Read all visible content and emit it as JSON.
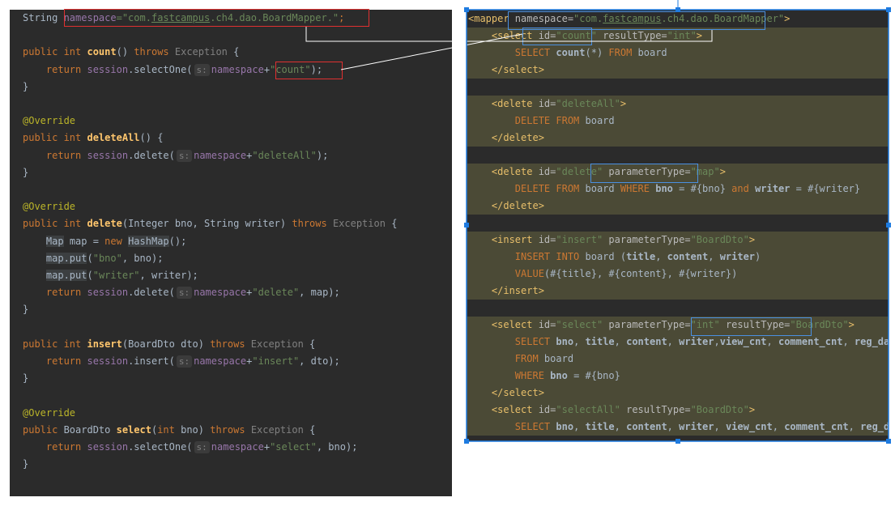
{
  "java": {
    "lines": [
      [
        {
          "t": "String ",
          "c": "mtd"
        },
        {
          "t": "namespace",
          "c": "fld"
        },
        {
          "t": "=\"com.",
          "c": "str"
        },
        {
          "t": "fastcampus",
          "c": "str ul"
        },
        {
          "t": ".ch4.dao.BoardMapper.\"",
          "c": "str"
        },
        {
          "t": ";",
          "c": "kw"
        }
      ],
      [],
      [
        {
          "t": "public int ",
          "c": "kw"
        },
        {
          "t": "count",
          "c": "fn"
        },
        {
          "t": "() ",
          "c": "mtd"
        },
        {
          "t": "throws ",
          "c": "kw"
        },
        {
          "t": "Exception",
          "c": "cls"
        },
        {
          "t": " {",
          "c": "mtd"
        }
      ],
      [
        {
          "t": "    return ",
          "c": "kw"
        },
        {
          "t": "session",
          "c": "fld"
        },
        {
          "t": ".selectOne(",
          "c": "mtd"
        },
        {
          "t": "s:",
          "c": "hint"
        },
        {
          "t": "namespace",
          "c": "fld"
        },
        {
          "t": "+",
          "c": "mtd"
        },
        {
          "t": "\"count\"",
          "c": "str"
        },
        {
          "t": ");",
          "c": "mtd"
        }
      ],
      [
        {
          "t": "}",
          "c": "mtd"
        }
      ],
      [],
      [
        {
          "t": "@Override",
          "c": "ann"
        }
      ],
      [
        {
          "t": "public int ",
          "c": "kw"
        },
        {
          "t": "deleteAll",
          "c": "fn"
        },
        {
          "t": "() {",
          "c": "mtd"
        }
      ],
      [
        {
          "t": "    return ",
          "c": "kw"
        },
        {
          "t": "session",
          "c": "fld"
        },
        {
          "t": ".delete(",
          "c": "mtd"
        },
        {
          "t": "s:",
          "c": "hint"
        },
        {
          "t": "namespace",
          "c": "fld"
        },
        {
          "t": "+",
          "c": "mtd"
        },
        {
          "t": "\"deleteAll\"",
          "c": "str"
        },
        {
          "t": ");",
          "c": "mtd"
        }
      ],
      [
        {
          "t": "}",
          "c": "mtd"
        }
      ],
      [],
      [
        {
          "t": "@Override",
          "c": "ann"
        }
      ],
      [
        {
          "t": "public int ",
          "c": "kw"
        },
        {
          "t": "delete",
          "c": "fn"
        },
        {
          "t": "(Integer bno, String writer) ",
          "c": "mtd"
        },
        {
          "t": "throws ",
          "c": "kw"
        },
        {
          "t": "Exception",
          "c": "cls"
        },
        {
          "t": " {",
          "c": "mtd"
        }
      ],
      [
        {
          "t": "    ",
          "c": "mtd"
        },
        {
          "t": "Map",
          "c": "mtd var"
        },
        {
          "t": " map = ",
          "c": "mtd"
        },
        {
          "t": "new ",
          "c": "kw"
        },
        {
          "t": "HashMap",
          "c": "mtd var"
        },
        {
          "t": "();",
          "c": "mtd"
        }
      ],
      [
        {
          "t": "    ",
          "c": "mtd"
        },
        {
          "t": "map.put",
          "c": "mtd var"
        },
        {
          "t": "(",
          "c": "mtd"
        },
        {
          "t": "\"bno\"",
          "c": "str"
        },
        {
          "t": ", bno);",
          "c": "mtd"
        }
      ],
      [
        {
          "t": "    ",
          "c": "mtd"
        },
        {
          "t": "map.put",
          "c": "mtd var"
        },
        {
          "t": "(",
          "c": "mtd"
        },
        {
          "t": "\"writer\"",
          "c": "str"
        },
        {
          "t": ", writer);",
          "c": "mtd"
        }
      ],
      [
        {
          "t": "    return ",
          "c": "kw"
        },
        {
          "t": "session",
          "c": "fld"
        },
        {
          "t": ".delete(",
          "c": "mtd"
        },
        {
          "t": "s:",
          "c": "hint"
        },
        {
          "t": "namespace",
          "c": "fld"
        },
        {
          "t": "+",
          "c": "mtd"
        },
        {
          "t": "\"delete\"",
          "c": "str"
        },
        {
          "t": ", map);",
          "c": "mtd"
        }
      ],
      [
        {
          "t": "}",
          "c": "mtd"
        }
      ],
      [],
      [
        {
          "t": "public int ",
          "c": "kw"
        },
        {
          "t": "insert",
          "c": "fn"
        },
        {
          "t": "(BoardDto dto) ",
          "c": "mtd"
        },
        {
          "t": "throws ",
          "c": "kw"
        },
        {
          "t": "Exception",
          "c": "cls"
        },
        {
          "t": " {",
          "c": "mtd"
        }
      ],
      [
        {
          "t": "    return ",
          "c": "kw"
        },
        {
          "t": "session",
          "c": "fld"
        },
        {
          "t": ".insert(",
          "c": "mtd"
        },
        {
          "t": "s:",
          "c": "hint"
        },
        {
          "t": "namespace",
          "c": "fld"
        },
        {
          "t": "+",
          "c": "mtd"
        },
        {
          "t": "\"insert\"",
          "c": "str"
        },
        {
          "t": ", dto);",
          "c": "mtd"
        }
      ],
      [
        {
          "t": "}",
          "c": "mtd"
        }
      ],
      [],
      [
        {
          "t": "@Override",
          "c": "ann"
        }
      ],
      [
        {
          "t": "public ",
          "c": "kw"
        },
        {
          "t": "BoardDto ",
          "c": "mtd"
        },
        {
          "t": "select",
          "c": "fn"
        },
        {
          "t": "(",
          "c": "mtd"
        },
        {
          "t": "int ",
          "c": "kw"
        },
        {
          "t": "bno) ",
          "c": "mtd"
        },
        {
          "t": "throws ",
          "c": "kw"
        },
        {
          "t": "Exception",
          "c": "cls"
        },
        {
          "t": " {",
          "c": "mtd"
        }
      ],
      [
        {
          "t": "    return ",
          "c": "kw"
        },
        {
          "t": "session",
          "c": "fld"
        },
        {
          "t": ".selectOne(",
          "c": "mtd"
        },
        {
          "t": "s:",
          "c": "hint"
        },
        {
          "t": "namespace",
          "c": "fld"
        },
        {
          "t": "+",
          "c": "mtd"
        },
        {
          "t": "\"select\"",
          "c": "str"
        },
        {
          "t": ", bno);",
          "c": "mtd"
        }
      ],
      [
        {
          "t": "}",
          "c": "mtd"
        }
      ]
    ]
  },
  "xml": {
    "lines": [
      {
        "hl": false,
        "s": [
          {
            "t": "<mapper ",
            "c": "tag"
          },
          {
            "t": "namespace=",
            "c": "attr"
          },
          {
            "t": "\"com.",
            "c": "aval"
          },
          {
            "t": "fastcampus",
            "c": "aval ul"
          },
          {
            "t": ".ch4.dao.BoardMapper\"",
            "c": "aval"
          },
          {
            "t": ">",
            "c": "tag"
          }
        ]
      },
      {
        "hl": true,
        "s": [
          {
            "t": "    <select ",
            "c": "tag"
          },
          {
            "t": "id=",
            "c": "attr"
          },
          {
            "t": "\"count\" ",
            "c": "aval"
          },
          {
            "t": "resultType=",
            "c": "attr"
          },
          {
            "t": "\"int\"",
            "c": "aval"
          },
          {
            "t": ">",
            "c": "tag"
          }
        ]
      },
      {
        "hl": true,
        "s": [
          {
            "t": "        SELECT ",
            "c": "sqk"
          },
          {
            "t": "count",
            "c": "sqi"
          },
          {
            "t": "(*) ",
            "c": "mtd"
          },
          {
            "t": "FROM ",
            "c": "sqk"
          },
          {
            "t": "board",
            "c": "mtd"
          }
        ]
      },
      {
        "hl": true,
        "s": [
          {
            "t": "    </select>",
            "c": "tag"
          }
        ]
      },
      {
        "hl": false,
        "s": []
      },
      {
        "hl": true,
        "s": [
          {
            "t": "    <delete ",
            "c": "tag"
          },
          {
            "t": "id=",
            "c": "attr"
          },
          {
            "t": "\"deleteAll\"",
            "c": "aval"
          },
          {
            "t": ">",
            "c": "tag"
          }
        ]
      },
      {
        "hl": true,
        "s": [
          {
            "t": "        DELETE FROM ",
            "c": "sqk"
          },
          {
            "t": "board",
            "c": "mtd"
          }
        ]
      },
      {
        "hl": true,
        "s": [
          {
            "t": "    </delete>",
            "c": "tag"
          }
        ]
      },
      {
        "hl": false,
        "s": []
      },
      {
        "hl": true,
        "s": [
          {
            "t": "    <delete ",
            "c": "tag"
          },
          {
            "t": "id=",
            "c": "attr"
          },
          {
            "t": "\"delete\" ",
            "c": "aval"
          },
          {
            "t": "parameterType=",
            "c": "attr"
          },
          {
            "t": "\"map\"",
            "c": "aval"
          },
          {
            "t": ">",
            "c": "tag"
          }
        ]
      },
      {
        "hl": true,
        "s": [
          {
            "t": "        DELETE FROM ",
            "c": "sqk"
          },
          {
            "t": "board ",
            "c": "mtd"
          },
          {
            "t": "WHERE ",
            "c": "sqk"
          },
          {
            "t": "bno ",
            "c": "sqi"
          },
          {
            "t": "= #{bno} ",
            "c": "mtd"
          },
          {
            "t": "and ",
            "c": "sqk"
          },
          {
            "t": "writer ",
            "c": "sqi"
          },
          {
            "t": "= #{writer}",
            "c": "mtd"
          }
        ]
      },
      {
        "hl": true,
        "s": [
          {
            "t": "    </delete>",
            "c": "tag"
          }
        ]
      },
      {
        "hl": false,
        "s": []
      },
      {
        "hl": true,
        "s": [
          {
            "t": "    <insert ",
            "c": "tag"
          },
          {
            "t": "id=",
            "c": "attr"
          },
          {
            "t": "\"insert\" ",
            "c": "aval"
          },
          {
            "t": "parameterType=",
            "c": "attr"
          },
          {
            "t": "\"BoardDto\"",
            "c": "aval"
          },
          {
            "t": ">",
            "c": "tag"
          }
        ]
      },
      {
        "hl": true,
        "s": [
          {
            "t": "        INSERT INTO ",
            "c": "sqk"
          },
          {
            "t": "board (",
            "c": "mtd"
          },
          {
            "t": "title",
            "c": "sqi"
          },
          {
            "t": ", ",
            "c": "mtd"
          },
          {
            "t": "content",
            "c": "sqi"
          },
          {
            "t": ", ",
            "c": "mtd"
          },
          {
            "t": "writer",
            "c": "sqi"
          },
          {
            "t": ")",
            "c": "mtd"
          }
        ]
      },
      {
        "hl": true,
        "s": [
          {
            "t": "        VALUE",
            "c": "sqk"
          },
          {
            "t": "(#{title}, #{content}, #{writer})",
            "c": "mtd"
          }
        ]
      },
      {
        "hl": true,
        "s": [
          {
            "t": "    </insert>",
            "c": "tag"
          }
        ]
      },
      {
        "hl": false,
        "s": []
      },
      {
        "hl": true,
        "s": [
          {
            "t": "    <select ",
            "c": "tag"
          },
          {
            "t": "id=",
            "c": "attr"
          },
          {
            "t": "\"select\" ",
            "c": "aval"
          },
          {
            "t": "parameterType=",
            "c": "attr"
          },
          {
            "t": "\"int\" ",
            "c": "aval"
          },
          {
            "t": "resultType=",
            "c": "attr"
          },
          {
            "t": "\"BoardDto\"",
            "c": "aval"
          },
          {
            "t": ">",
            "c": "tag"
          }
        ]
      },
      {
        "hl": true,
        "s": [
          {
            "t": "        SELECT ",
            "c": "sqk"
          },
          {
            "t": "bno",
            "c": "sqi"
          },
          {
            "t": ", ",
            "c": "mtd"
          },
          {
            "t": "title",
            "c": "sqi"
          },
          {
            "t": ", ",
            "c": "mtd"
          },
          {
            "t": "content",
            "c": "sqi"
          },
          {
            "t": ", ",
            "c": "mtd"
          },
          {
            "t": "writer",
            "c": "sqi"
          },
          {
            "t": ",",
            "c": "mtd"
          },
          {
            "t": "view_cnt",
            "c": "sqi"
          },
          {
            "t": ", ",
            "c": "mtd"
          },
          {
            "t": "comment_cnt",
            "c": "sqi"
          },
          {
            "t": ", ",
            "c": "mtd"
          },
          {
            "t": "reg_date",
            "c": "sqi"
          }
        ]
      },
      {
        "hl": true,
        "s": [
          {
            "t": "        FROM ",
            "c": "sqk"
          },
          {
            "t": "board",
            "c": "mtd"
          }
        ]
      },
      {
        "hl": true,
        "s": [
          {
            "t": "        WHERE ",
            "c": "sqk"
          },
          {
            "t": "bno ",
            "c": "sqi"
          },
          {
            "t": "= #{bno}",
            "c": "mtd"
          }
        ]
      },
      {
        "hl": true,
        "s": [
          {
            "t": "    </select>",
            "c": "tag"
          }
        ]
      },
      {
        "hl": true,
        "s": [
          {
            "t": "    <select ",
            "c": "tag"
          },
          {
            "t": "id=",
            "c": "attr"
          },
          {
            "t": "\"selectAll\" ",
            "c": "aval"
          },
          {
            "t": "resultType=",
            "c": "attr"
          },
          {
            "t": "\"BoardDto\"",
            "c": "aval"
          },
          {
            "t": ">",
            "c": "tag"
          }
        ]
      },
      {
        "hl": true,
        "s": [
          {
            "t": "        SELECT ",
            "c": "sqk"
          },
          {
            "t": "bno",
            "c": "sqi"
          },
          {
            "t": ", ",
            "c": "mtd"
          },
          {
            "t": "title",
            "c": "sqi"
          },
          {
            "t": ", ",
            "c": "mtd"
          },
          {
            "t": "content",
            "c": "sqi"
          },
          {
            "t": ", ",
            "c": "mtd"
          },
          {
            "t": "writer",
            "c": "sqi"
          },
          {
            "t": ", ",
            "c": "mtd"
          },
          {
            "t": "view_cnt",
            "c": "sqi"
          },
          {
            "t": ", ",
            "c": "mtd"
          },
          {
            "t": "comment_cnt",
            "c": "sqi"
          },
          {
            "t": ", ",
            "c": "mtd"
          },
          {
            "t": "reg_date",
            "c": "sqi"
          }
        ]
      }
    ]
  },
  "colors": {
    "highlight_red": "#e03030",
    "highlight_blue": "#4a90e2",
    "editor_bg": "#2b2b2b",
    "selection_handle": "#1e7be0"
  }
}
